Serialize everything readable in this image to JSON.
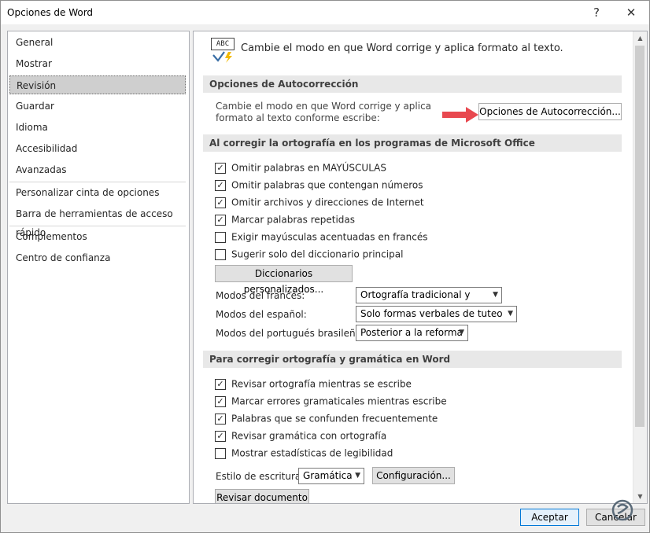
{
  "window": {
    "title": "Opciones de Word",
    "help": "?",
    "close": "✕"
  },
  "sidebar": {
    "items": [
      {
        "label": "General"
      },
      {
        "label": "Mostrar"
      },
      {
        "label": "Revisión",
        "selected": true
      },
      {
        "label": "Guardar"
      },
      {
        "label": "Idioma"
      },
      {
        "label": "Accesibilidad"
      },
      {
        "label": "Avanzadas"
      },
      {
        "label": "Personalizar cinta de opciones"
      },
      {
        "label": "Barra de herramientas de acceso rápido"
      },
      {
        "label": "Complementos"
      },
      {
        "label": "Centro de confianza"
      }
    ]
  },
  "content": {
    "icon_text": "ABC",
    "intro": "Cambie el modo en que Word corrige y aplica formato al texto.",
    "autocorrect": {
      "header": "Opciones de Autocorrección",
      "desc": "Cambie el modo en que Word corrige y aplica formato al texto conforme escribe:",
      "button": "Opciones de Autocorrección..."
    },
    "office": {
      "header": "Al corregir la ortografía en los programas de Microsoft Office",
      "checks": [
        {
          "label": "Omitir palabras en MAYÚSCULAS",
          "checked": true
        },
        {
          "label": "Omitir palabras que contengan números",
          "checked": true
        },
        {
          "label": "Omitir archivos y direcciones de Internet",
          "checked": true
        },
        {
          "label": "Marcar palabras repetidas",
          "checked": true
        },
        {
          "label": "Exigir mayúsculas acentuadas en francés",
          "checked": false
        },
        {
          "label": "Sugerir solo del diccionario principal",
          "checked": false
        }
      ],
      "dict_button": "Diccionarios personalizados...",
      "modes": [
        {
          "label": "Modos del francés:",
          "value": "Ortografía tradicional y nueva"
        },
        {
          "label": "Modos del español:",
          "value": "Solo formas verbales de tuteo"
        },
        {
          "label": "Modos del portugués brasileño:",
          "value": "Posterior a la reforma"
        }
      ]
    },
    "word": {
      "header": "Para corregir ortografía y gramática en Word",
      "checks": [
        {
          "label": "Revisar ortografía mientras se escribe",
          "checked": true
        },
        {
          "label": "Marcar errores gramaticales mientras escribe",
          "checked": true
        },
        {
          "label": "Palabras que se confunden frecuentemente",
          "checked": true
        },
        {
          "label": "Revisar gramática con ortografía",
          "checked": true
        },
        {
          "label": "Mostrar estadísticas de legibilidad",
          "checked": false
        }
      ],
      "style_label": "Estilo de escritura:",
      "style_value": "Gramática",
      "config_button": "Configuración...",
      "review_button": "Revisar documento"
    }
  },
  "footer": {
    "accept": "Aceptar",
    "cancel": "Cancelar"
  },
  "colors": {
    "accent": "#0078d7",
    "arrow": "#e8484f",
    "watermark": "#5a6a78"
  }
}
